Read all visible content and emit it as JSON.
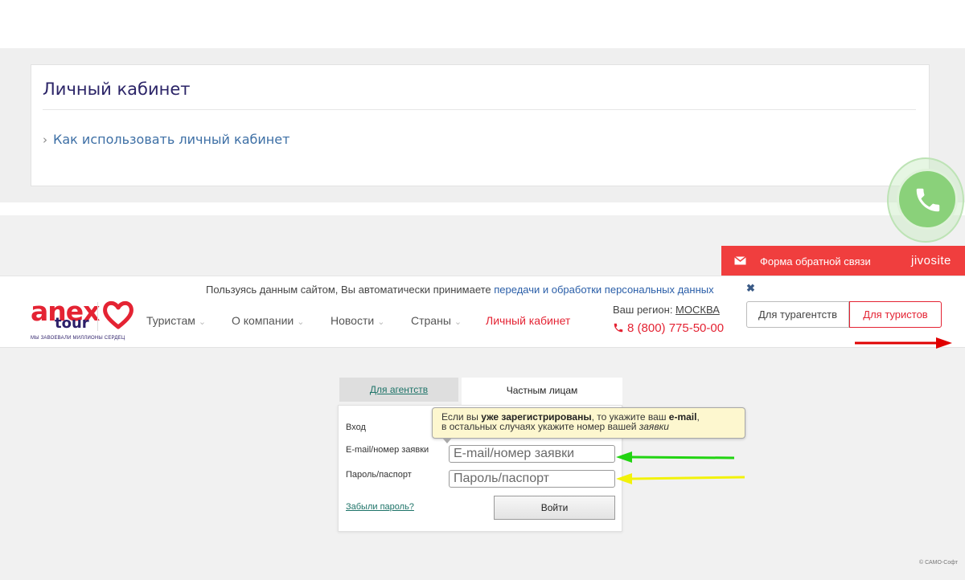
{
  "cabinet": {
    "title": "Личный кабинет",
    "how_to_link": "Как использовать личный кабинет",
    "chevron": "›"
  },
  "call_widget": {
    "icon": "phone-icon",
    "color": "#8ad17a"
  },
  "feedback": {
    "label": "Форма обратной связи",
    "brand": "jivosite",
    "icon": "envelope-icon",
    "color": "#f03e3e"
  },
  "consent": {
    "text": "Пользуясь данным сайтом, Вы автоматически принимаете ",
    "link": "передачи и обработки персональных данных",
    "close": "✖"
  },
  "header": {
    "logo": {
      "anex": "anex",
      "tour": "tour",
      "slogan": "МЫ ЗАВОЕВАЛИ МИЛЛИОНЫ СЕРДЕЦ",
      "icon": "heart-logo-icon"
    },
    "nav": [
      {
        "label": "Туристам",
        "arrow": "⌄"
      },
      {
        "label": "О компании",
        "arrow": "⌄"
      },
      {
        "label": "Новости",
        "arrow": "⌄"
      },
      {
        "label": "Страны",
        "arrow": "⌄"
      },
      {
        "label": "Личный кабинет"
      }
    ],
    "region_label": "Ваш регион: ",
    "region_city": "МОСКВА",
    "phone": "8 (800) 775-50-00",
    "btn_agent": "Для турагентств",
    "btn_tourist": "Для туристов",
    "brand_color": "#e42333"
  },
  "login": {
    "tab_agents": "Для агентств",
    "tab_private": "Частным лицам",
    "label_login": "Вход",
    "label_email": "E-mail/номер заявки",
    "label_password": "Пароль/паспорт",
    "placeholder_email": "E-mail/номер заявки",
    "placeholder_password": "Пароль/паспорт",
    "forgot": "Забыли пароль?",
    "submit": "Войти"
  },
  "tooltip": {
    "p1": "Если вы ",
    "b1": "уже зарегистрированы",
    "p2": ", то укажите ваш ",
    "b2": "e-mail",
    "p3": ",",
    "p4": "в остальных случаях укажите номер вашей ",
    "i1": "заявки"
  },
  "annotations": [
    {
      "name": "red-arrow",
      "color": "#e00000"
    },
    {
      "name": "green-arrow",
      "color": "#22d412"
    },
    {
      "name": "yellow-arrow",
      "color": "#f2f20a"
    }
  ],
  "copyright": "© САМО-Софт"
}
